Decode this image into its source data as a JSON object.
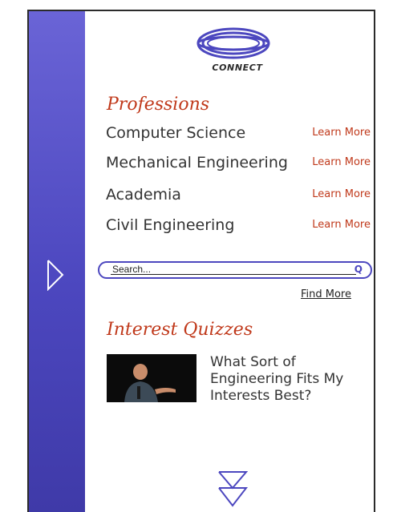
{
  "brand": {
    "logo_text": "CONNECT"
  },
  "professions": {
    "title": "Professions",
    "items": [
      {
        "name": "Computer Science",
        "link": "Learn More"
      },
      {
        "name": "Mechanical Engineering",
        "link": "Learn More"
      },
      {
        "name": "Academia",
        "link": "Learn More"
      },
      {
        "name": "Civil Engineering",
        "link": "Learn More"
      }
    ]
  },
  "search": {
    "placeholder": "Search...",
    "icon": "Q"
  },
  "find_more": "Find More",
  "quizzes": {
    "title": "Interest Quizzes",
    "items": [
      {
        "text": "What Sort of Engineering Fits My Interests Best?"
      }
    ]
  },
  "colors": {
    "accent": "#4c47bf",
    "link": "#c0391b",
    "sidebar_top": "#6a64d6",
    "sidebar_bottom": "#3f3aa8"
  }
}
